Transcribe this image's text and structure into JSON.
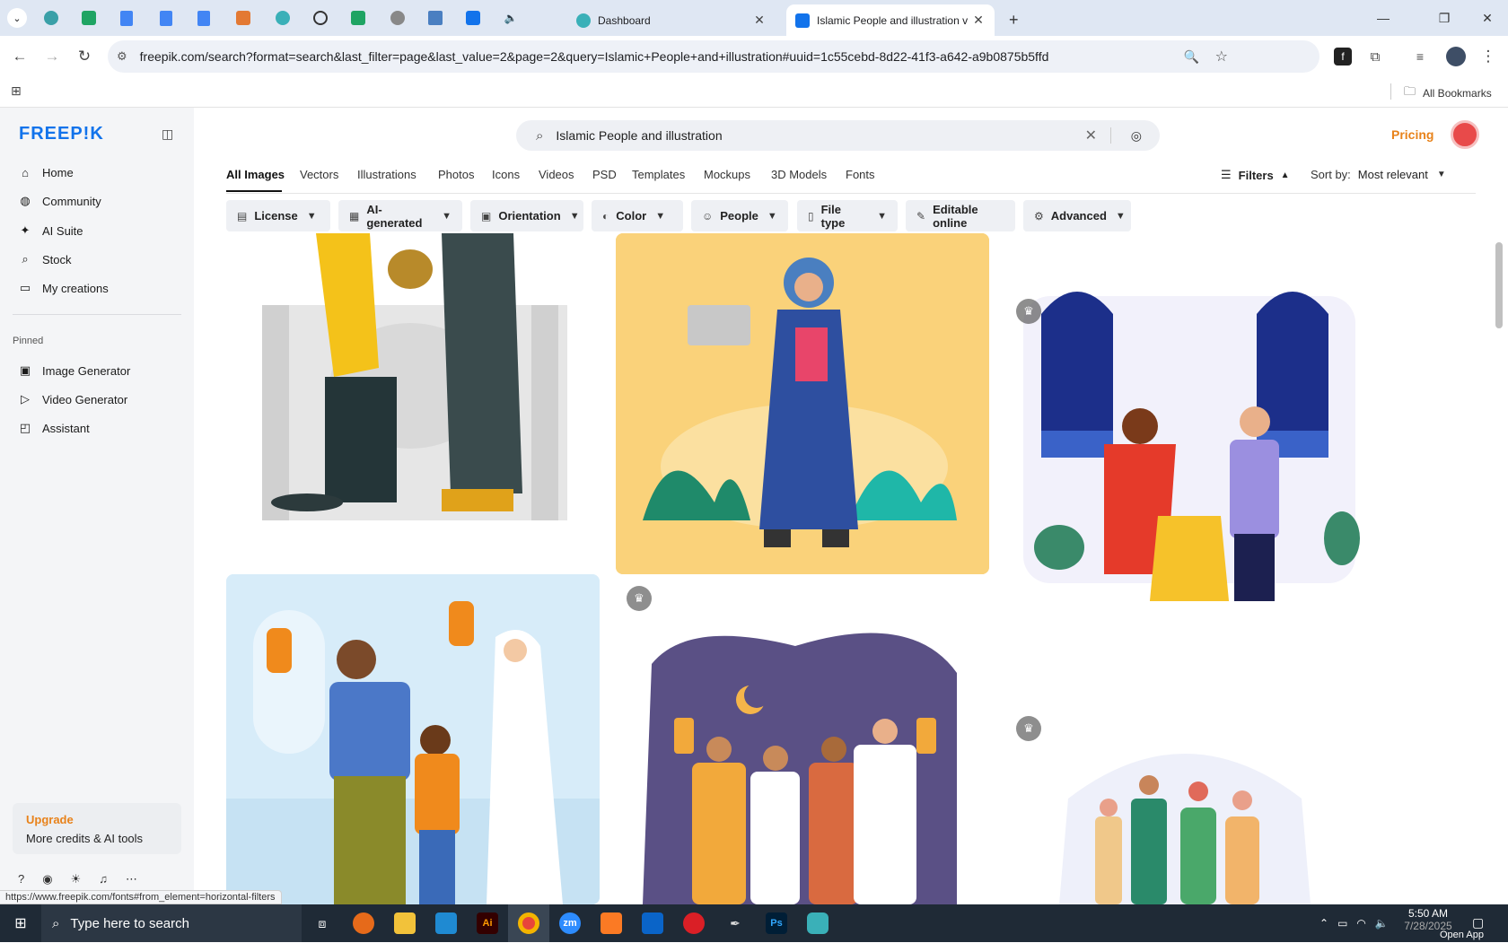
{
  "browser": {
    "tabs": [
      {
        "title": "Dashboard",
        "active": false
      },
      {
        "title": "Islamic People and illustration v",
        "active": true
      }
    ],
    "new_tab": "+",
    "url": "freepik.com/search?format=search&last_filter=page&last_value=2&page=2&query=Islamic+People+and+illustration#uuid=1c55cebd-8d22-41f3-a642-a9b0875b5ffd",
    "bookmarks_label": "All Bookmarks",
    "status_link": "https://www.freepik.com/fonts#from_element=horizontal-filters"
  },
  "sidebar": {
    "logo": "FREEP!K",
    "nav": [
      {
        "label": "Home",
        "icon": "home-icon"
      },
      {
        "label": "Community",
        "icon": "globe-icon"
      },
      {
        "label": "AI Suite",
        "icon": "sparkle-icon"
      },
      {
        "label": "Stock",
        "icon": "search-icon"
      },
      {
        "label": "My creations",
        "icon": "folder-icon"
      }
    ],
    "pinned_heading": "Pinned",
    "pinned": [
      {
        "label": "Image Generator",
        "icon": "image-icon"
      },
      {
        "label": "Video Generator",
        "icon": "video-icon"
      },
      {
        "label": "Assistant",
        "icon": "assistant-icon"
      }
    ],
    "upgrade": {
      "title": "Upgrade",
      "subtitle": "More credits & AI tools"
    }
  },
  "header": {
    "search_value": "Islamic People and illustration",
    "pricing": "Pricing"
  },
  "categories": [
    "All Images",
    "Vectors",
    "Illustrations",
    "Photos",
    "Icons",
    "Videos",
    "PSD",
    "Templates",
    "Mockups",
    "3D Models",
    "Fonts"
  ],
  "active_category": "All Images",
  "filters_label": "Filters",
  "sort": {
    "label": "Sort by:",
    "value": "Most relevant"
  },
  "chips": [
    {
      "label": "License",
      "icon": "license-icon"
    },
    {
      "label": "AI-generated",
      "icon": "ai-icon"
    },
    {
      "label": "Orientation",
      "icon": "orientation-icon"
    },
    {
      "label": "Color",
      "icon": "palette-icon"
    },
    {
      "label": "People",
      "icon": "people-icon"
    },
    {
      "label": "File type",
      "icon": "file-icon"
    },
    {
      "label": "Editable online",
      "icon": "brush-icon"
    },
    {
      "label": "Advanced",
      "icon": "gear-icon"
    }
  ],
  "taskbar": {
    "search_placeholder": "Type here to search",
    "time": "5:50 AM",
    "date": "7/28/2025",
    "open_app": "Open App"
  },
  "colors": {
    "brand": "#1273eb",
    "pricing": "#e8821a",
    "upgrade": "#e8821a"
  }
}
